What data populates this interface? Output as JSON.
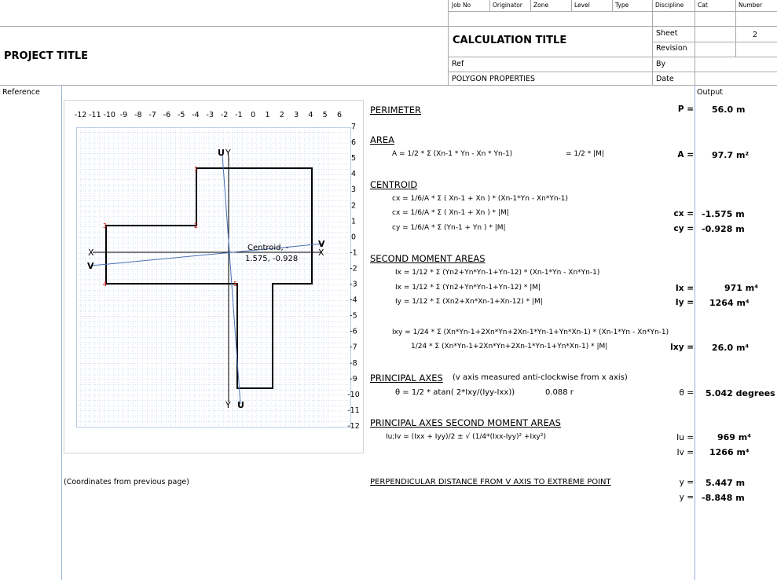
{
  "header": {
    "project_title": "PROJECT TITLE",
    "calc_title": "CALCULATION TITLE",
    "ref_label": "Ref",
    "ref_value": "POLYGON PROPERTIES",
    "cols": [
      "Job No",
      "Originator",
      "Zone",
      "Level",
      "Type",
      "Discipline",
      "Cat",
      "Number"
    ],
    "sheet_label": "Sheet",
    "sheet_value": "2",
    "revision_label": "Revision",
    "by_label": "By",
    "date_label": "Date"
  },
  "reference_label": "Reference",
  "output_label": "Output",
  "diagram": {
    "x_ticks": [
      "-12",
      "-11",
      "-10",
      "-9",
      "-8",
      "-7",
      "-6",
      "-5",
      "-4",
      "-3",
      "-2",
      "-1",
      "0",
      "1",
      "2",
      "3",
      "4",
      "5",
      "6"
    ],
    "y_ticks": [
      "7",
      "6",
      "5",
      "4",
      "3",
      "2",
      "1",
      "0",
      "-1",
      "-2",
      "-3",
      "-4",
      "-5",
      "-6",
      "-7",
      "-8",
      "-9",
      "-10",
      "-11",
      "-12"
    ],
    "centroid_line1": "Centroid, -",
    "centroid_line2": "1.575, -0.928",
    "axis_x": "X",
    "axis_y": "Y",
    "axis_u": "U",
    "axis_v": "V",
    "vertex_labels": [
      "1",
      "2",
      "3",
      "4",
      "5"
    ],
    "outline_color": "#000000",
    "axis_color": "#4a6fb5",
    "grid_color": "#b9cbe6"
  },
  "coords_note": "(Coordinates from previous page)",
  "sections": {
    "perimeter": {
      "heading": "PERIMETER",
      "label": "P =",
      "value": "56.0 m"
    },
    "area": {
      "heading": "AREA",
      "formula": "A =  1/2 * Σ (Xn-1 * Yn - Xn * Yn-1)",
      "formula2": "= 1/2 * |M|",
      "label": "A =",
      "value": "97.7 m²"
    },
    "centroid": {
      "heading": "CENTROID",
      "f1": "cx = 1/6/A * Σ ( Xn-1 + Xn ) * (Xn-1*Yn - Xn*Yn-1)",
      "f2": "cx = 1/6/A * Σ ( Xn-1 + Xn ) * |M|",
      "f3": "cy = 1/6/A * Σ (Yn-1 + Yn ) * |M|",
      "cx_label": "cx =",
      "cx_value": "-1.575 m",
      "cy_label": "cy =",
      "cy_value": "-0.928 m"
    },
    "second_moment": {
      "heading": "SECOND MOMENT AREAS",
      "f1": "Ix = 1/12 * Σ (Yn2+Yn*Yn-1+Yn-12)  * (Xn-1*Yn - Xn*Yn-1)",
      "f2": "Ix = 1/12 * Σ (Yn2+Yn*Yn-1+Yn-12)  * |M|",
      "f3": "Iy = 1/12 * Σ (Xn2+Xn*Xn-1+Xn-12)  * |M|",
      "f4": "Ixy = 1/24 * Σ (Xn*Yn-1+2Xn*Yn+2Xn-1*Yn-1+Yn*Xn-1)  * (Xn-1*Yn - Xn*Yn-1)",
      "f5": "1/24 * Σ (Xn*Yn-1+2Xn*Yn+2Xn-1*Yn-1+Yn*Xn-1)  * |M|",
      "ix_label": "Ix =",
      "ix_value": "971 m⁴",
      "iy_label": "Iy =",
      "iy_value": "1264 m⁴",
      "ixy_label": "Ixy =",
      "ixy_value": "26.0 m⁴"
    },
    "principal_axes": {
      "heading": "PRINCIPAL AXES",
      "note": "(v axis measured anti-clockwise from x axis)",
      "formula": "θ = 1/2 * atan( 2*Ixy/(Iyy-Ixx))",
      "rad": "0.088  r",
      "label": "θ =",
      "value": "5.042  degrees"
    },
    "principal_moments": {
      "heading": "PRINCIPAL AXES SECOND MOMENT AREAS",
      "formula": "Iu;Iv =  (Ixx + Iyy)/2 ± √ (1/4*(Ixx-Iyy)² +Ixy²)",
      "iu_label": "Iu =",
      "iu_value": "969 m⁴",
      "iv_label": "Iv =",
      "iv_value": "1266 m⁴"
    },
    "distance": {
      "heading": "PERPENDICULAR DISTANCE FROM V AXIS TO EXTREME POINT",
      "y1_label": "y =",
      "y1_value": "5.447 m",
      "y2_label": "y =",
      "y2_value": "-8.848 m"
    }
  }
}
